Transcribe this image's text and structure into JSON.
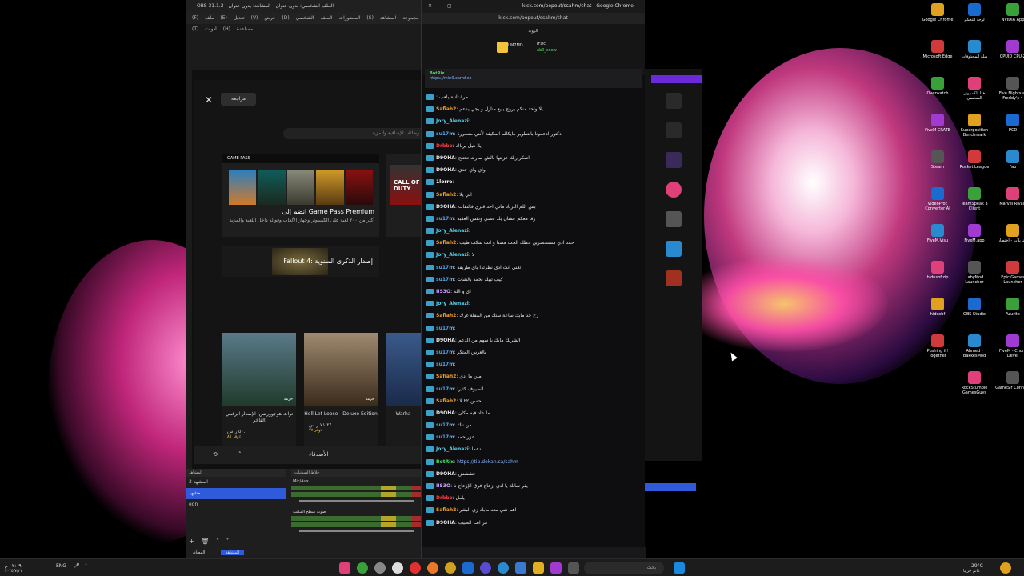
{
  "obs": {
    "title": "OBS 31.1.2 - الملف الشخصي: بدون عنوان - المشاهد: بدون عنوان",
    "menu": "(F) ملف  (E) تعديل  (V) عرض  (D) المنظورات  الملف الشخصي  (S) مجموعة المشاهد  (T) أدوات  (H) مساعدة",
    "scenes_header": "المشاهد",
    "scenes": [
      "المشهد 2",
      "مشهد",
      "edn"
    ],
    "mixer_header": "خلاط الصوتيات",
    "track1": "Mic/Aux",
    "track2": "صوت سطح المكتب",
    "mode_tabs": [
      "المصادر",
      "المشاهد"
    ]
  },
  "store": {
    "review_label": "مراجعة",
    "search_placeholder": "وظائف الإضافية والمزيد",
    "gp_badge": "GAME PASS",
    "gp_title": "انضم إلى Game Pass Premium",
    "gp_desc": "أكثر من ٢٠٠ لعبة على الكمبيوتر وجهاز الألعاب وفوائد داخل اللعبة والمزيد",
    "cod_label": "CALL OF DUTY",
    "fallout_title": "Fallout 4: إصدار الذكرى السنوية",
    "tiles": [
      {
        "title": "تراث هوجوورتس: الإصدار الرقمي الفاخر",
        "price": "٥٠ ر.س.",
        "discount": "وفر ٨٥٪",
        "badge": "حزمة"
      },
      {
        "title": "Hell Let Loose - Deluxe Edition",
        "price": "٧١,٢٤ ر.س.",
        "discount": "وفر ٧٧٪",
        "badge": "حزمة"
      },
      {
        "title": "Warha",
        "price": "",
        "discount": "",
        "badge": ""
      }
    ],
    "friends_label": "الأصدقاء"
  },
  "chat": {
    "window_title": "kick.com/popout/ssahm/chat - Google Chrome",
    "url": "kick.com/popout/ssahm/chat",
    "top_label": "الرؤية",
    "top_users": [
      "IIM7MD",
      "IFDc",
      "ab0_snow"
    ],
    "pinned_user": "BotRix",
    "pinned_text": "https://min0.carrd.co",
    "messages": [
      {
        "user": "",
        "text": "مرة ثانية يلعب"
      },
      {
        "user": "Safiah2",
        "text": "يلا واحد منكم يروح يبيع منازل و يجي يدعم"
      },
      {
        "user": "Jory_Alenazi",
        "text": ""
      },
      {
        "user": "su17m",
        "text": "دكتور ادعمونا بالتطوير مايكالم المكيفة لأنني متصررة"
      },
      {
        "user": "Drbbo",
        "text": "يلا هيل يرناك"
      },
      {
        "user": "D9OHA",
        "text": "اشكر ربك عزيتها بالش صارت تختلج"
      },
      {
        "user": "D9OHA",
        "text": "واي واي جدي"
      },
      {
        "user": "1lorre",
        "text": ""
      },
      {
        "user": "Safiah2",
        "text": "ابي يلا"
      },
      {
        "user": "D9OHA",
        "text": "بس اللم البرناد ماتي احد قبري فالتفات"
      },
      {
        "user": "su17m",
        "text": "رفا معكم عشان يلد عصي ونفس العقبه"
      },
      {
        "user": "Jory_Alenazi",
        "text": ""
      },
      {
        "user": "Safiah2",
        "text": "حمد ادي مستحضرين حظك الحب مصنا و انت سكت طيب"
      },
      {
        "user": "Jory_Alenazi",
        "text": "لا"
      },
      {
        "user": "su17m",
        "text": "تعني انت ادي نظرتدا باي طريقه"
      },
      {
        "user": "su17m",
        "text": "كيف تبيك نحمد بالشات"
      },
      {
        "user": "IIS3O",
        "text": "اي و الله"
      },
      {
        "user": "Jory_Alenazi",
        "text": ""
      },
      {
        "user": "Safiah2",
        "text": "رح خذ مابك ساعة ستك من المقلة غرك"
      },
      {
        "user": "su17m",
        "text": ""
      },
      {
        "user": "D9OHA",
        "text": "الشريك مابك يا سهم من الدعم"
      },
      {
        "user": "su17m",
        "text": "يالعرس المتكر"
      },
      {
        "user": "su17m",
        "text": ""
      },
      {
        "user": "Safiah2",
        "text": "مين ما ادي"
      },
      {
        "user": "su17m",
        "text": "الضيوف كثيرا"
      },
      {
        "user": "Safiah2",
        "text": "حسن ٢٢ لا"
      },
      {
        "user": "D9OHA",
        "text": "ما عاد فيه مكان"
      },
      {
        "user": "su17m",
        "text": "من ناك"
      },
      {
        "user": "su17m",
        "text": "عزر حمد"
      },
      {
        "user": "Jory_Alenazi",
        "text": "دعما"
      },
      {
        "user": "BotRix",
        "text": "https://tip.dokan.sa/sahm"
      },
      {
        "user": "D9OHA",
        "text": "حششش"
      },
      {
        "user": "IIS3O",
        "text": "يفر شابك يا ادي إزعاج فرق الإزعاج نا"
      },
      {
        "user": "Drbbo",
        "text": "يامل"
      },
      {
        "user": "Safiah2",
        "text": "اهم شي معه مابك زي البشر"
      },
      {
        "user": "D9OHA",
        "text": "مر انت الضيف"
      }
    ]
  },
  "desktop_icons": [
    "NVIDIA App",
    "لوحة التحكم",
    "Google Chrome",
    "CPUID CPU-Z",
    "سلة المحذوفات",
    "Microsoft Edge",
    "Five Nights at Freddy's 4",
    "هذا الكمبيوتر الشخصي",
    "Overwatch",
    "PCD",
    "Superposition Benchmark",
    "FiveM CRATE",
    "Fab",
    "Rocket League",
    "Steam",
    "Marvel Rivals",
    "TeamSpeak 3 Client",
    "VideoProc Converter AI",
    "التنزيلات - اختصار",
    "FiveM.app",
    "FiveM.Visu",
    "Epic Games Launcher",
    "LabyMod Launcher",
    "hidusbf.zip",
    "Azurite",
    "OBS Studio",
    "hidusbf",
    "FiveM - Chore Devel",
    "Ahmed - BakkesMod",
    "Pushing it! Together",
    "GameSir Connect",
    "RockStumble GamesGuys"
  ],
  "taskbar": {
    "search_placeholder": "بحث",
    "lang": "ENG",
    "time": "٠٢:٠٩ م",
    "date": "٢٠٢٥/٧/٢٢",
    "weather_temp": "29°C",
    "weather_desc": "غائم جزئيا"
  },
  "colors": {
    "safiah": "#f0a030",
    "jory": "#5ad1e8",
    "su17m": "#52a6e8",
    "d9oha": "#e8e8e8",
    "iis3o": "#c9a0ff",
    "botrix": "#4de060",
    "drbbo": "#e8404a",
    "lorre": "#ffffff",
    "obs_selected": "#2f5ad9"
  }
}
